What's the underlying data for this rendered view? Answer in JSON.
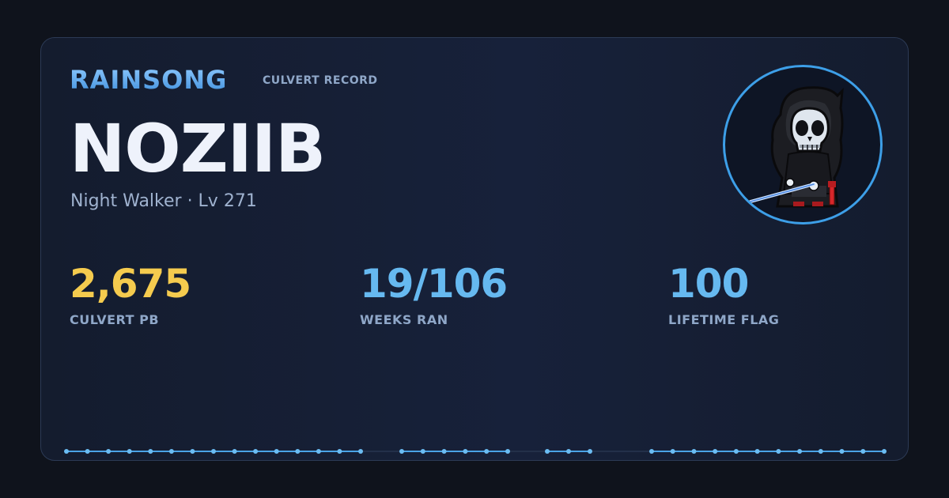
{
  "header": {
    "brand": "RAINSONG",
    "record_label": "CULVERT RECORD"
  },
  "character": {
    "name": "NOZIIB",
    "subtitle": "Night Walker · Lv 271",
    "avatar_icon": "reaper-character-sprite"
  },
  "stats": [
    {
      "value": "2,675",
      "label": "CULVERT PB",
      "color": "#f5cb4e"
    },
    {
      "value": "19/106",
      "label": "WEEKS RAN",
      "color": "#66b9f0"
    },
    {
      "value": "100",
      "label": "LIFETIME FLAG",
      "color": "#66b9f0"
    }
  ],
  "colors": {
    "accent": "#3d9fe8",
    "timeline_line": "#4aa3e6",
    "timeline_dot": "#6bbcf2",
    "timeline_gap": "#233049"
  },
  "timeline": {
    "total_weeks": 106,
    "weeks_ran": 19
  }
}
